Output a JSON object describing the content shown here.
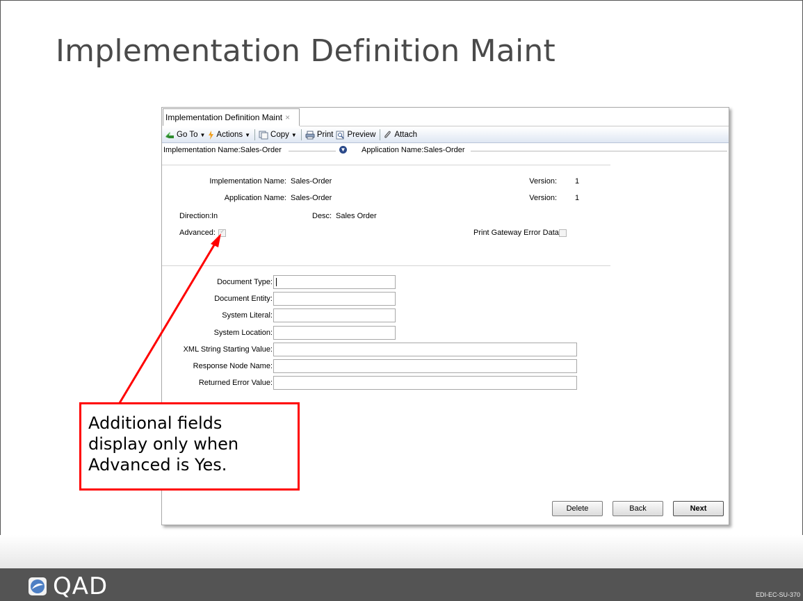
{
  "slide": {
    "title": "Implementation Definition Maint",
    "footer_brand": "QAD",
    "slide_code": "EDI-EC-SU-370"
  },
  "window": {
    "tab_title": "Implementation Definition Maint",
    "tab_close": "×",
    "toolbar": {
      "goto": "Go To",
      "actions": "Actions",
      "copy": "Copy",
      "print": "Print",
      "preview": "Preview",
      "attach": "Attach"
    },
    "breadcrumb": {
      "implementation": "Implementation Name:Sales-Order",
      "application": "Application Name:Sales-Order"
    },
    "summary": {
      "implementation_label": "Implementation Name:",
      "implementation_value": "Sales-Order",
      "application_label": "Application Name:",
      "application_value": "Sales-Order",
      "version_label_1": "Version:",
      "version_value_1": "1",
      "version_label_2": "Version:",
      "version_value_2": "1",
      "direction_label": "Direction:",
      "direction_value": "In",
      "desc_label": "Desc:",
      "desc_value": "Sales Order",
      "advanced_label": "Advanced:",
      "advanced_checked": true,
      "print_gateway_label": "Print Gateway Error Data:",
      "print_gateway_checked": false
    },
    "fields": {
      "document_type": "Document Type:",
      "document_entity": "Document Entity:",
      "system_literal": "System Literal:",
      "system_location": "System Location:",
      "xml_string": "XML String Starting Value:",
      "response_node": "Response Node Name:",
      "returned_error": "Returned Error Value:"
    },
    "buttons": {
      "delete": "Delete",
      "back": "Back",
      "next": "Next"
    }
  },
  "callout": {
    "line1": "Additional fields",
    "line2": "display only when",
    "line3": "Advanced is Yes.",
    "border_color": "#ff0000"
  }
}
